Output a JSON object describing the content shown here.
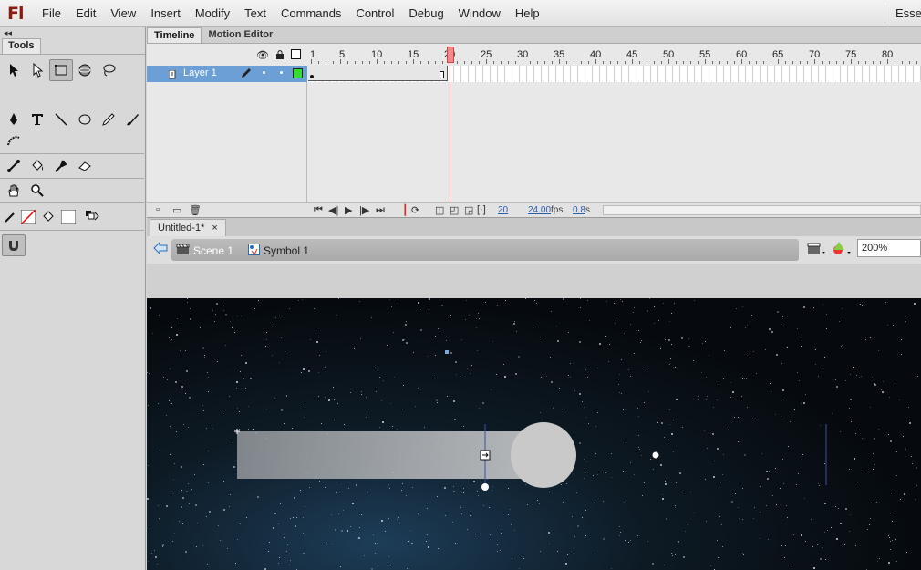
{
  "app": {
    "logo": "Fl",
    "menus": [
      "File",
      "Edit",
      "View",
      "Insert",
      "Modify",
      "Text",
      "Commands",
      "Control",
      "Debug",
      "Window",
      "Help"
    ],
    "workspace": "Essen"
  },
  "tools": {
    "panel_title": "Tools",
    "collapse_glyph": "◂◂",
    "icons": [
      [
        "selection-tool-icon",
        "subselection-tool-icon",
        "free-transform-tool-icon",
        "3d-rotation-tool-icon",
        "lasso-tool-icon"
      ],
      [
        "pen-tool-icon",
        "text-tool-icon",
        "line-tool-icon",
        "oval-tool-icon",
        "pencil-tool-icon",
        "brush-tool-icon"
      ],
      [
        "deco-tool-icon"
      ],
      [
        "bone-tool-icon",
        "paint-bucket-tool-icon",
        "eyedropper-tool-icon",
        "eraser-tool-icon"
      ],
      [
        "hand-tool-icon",
        "zoom-tool-icon"
      ],
      [
        "stroke-color-icon",
        "fill-color-icon",
        "swap-colors-icon"
      ],
      [
        "snap-to-objects-icon"
      ]
    ]
  },
  "timeline": {
    "tabs": [
      "Timeline",
      "Motion Editor"
    ],
    "ruler": [
      "1",
      "5",
      "10",
      "15",
      "20",
      "25",
      "30",
      "35",
      "40",
      "45",
      "50",
      "55",
      "60",
      "65",
      "70",
      "75",
      "80"
    ],
    "layer_name": "Layer 1",
    "current_frame": "20",
    "fps": "24.00",
    "fps_unit": "fps",
    "elapsed": "0.8",
    "elapsed_unit": "s"
  },
  "document": {
    "tab_title": "Untitled-1*",
    "tab_close": "×",
    "scene": "Scene 1",
    "symbol": "Symbol 1",
    "zoom": "200%"
  },
  "colors": {
    "layer_highlight": "#6c9fd6",
    "playhead": "#d63a3a",
    "layer_color_box": "#33dd33",
    "stage_bg": "#0a1118"
  }
}
